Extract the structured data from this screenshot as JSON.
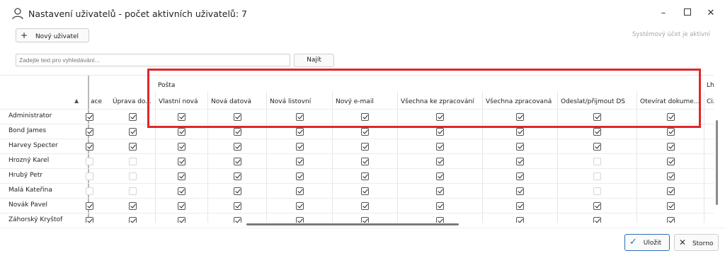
{
  "window": {
    "title": "Nastavení uživatelů - počet aktivních uživatelů: 7"
  },
  "toolbar": {
    "new_user": "Nový uživatel",
    "system_note": "Systémový účet je aktivní"
  },
  "search": {
    "placeholder": "Zadejte text pro vyhledávání...",
    "find_label": "Najít"
  },
  "grid": {
    "group_header": "Pošta",
    "partial_left": "ace",
    "partial_right_group": "Lhůty",
    "partial_right_col": "Cizí p",
    "columns": [
      "Úprava do...",
      "Vlastní nová",
      "Nová datová",
      "Nová listovní",
      "Nový e-mail",
      "Všechna ke zpracování",
      "Všechna zpracovaná",
      "Odeslat/přijmout DS",
      "Otevírat dokume..."
    ],
    "rows": [
      {
        "name": "Administrator",
        "values": [
          true,
          true,
          true,
          true,
          true,
          true,
          true,
          true,
          true,
          true
        ]
      },
      {
        "name": "Bond James",
        "values": [
          true,
          true,
          true,
          true,
          true,
          true,
          true,
          true,
          true,
          true
        ]
      },
      {
        "name": "Harvey Specter",
        "values": [
          true,
          true,
          true,
          true,
          true,
          true,
          true,
          true,
          true,
          true
        ]
      },
      {
        "name": "Hrozný Karel",
        "values": [
          false,
          false,
          true,
          true,
          true,
          true,
          true,
          true,
          false,
          true
        ]
      },
      {
        "name": "Hrubý Petr",
        "values": [
          false,
          false,
          true,
          true,
          true,
          true,
          true,
          true,
          false,
          true
        ]
      },
      {
        "name": "Malá Kateřina",
        "values": [
          false,
          false,
          true,
          true,
          true,
          true,
          true,
          true,
          false,
          true
        ]
      },
      {
        "name": "Novák Pavel",
        "values": [
          true,
          true,
          true,
          true,
          true,
          true,
          true,
          true,
          true,
          true
        ]
      },
      {
        "name": "Záhorský Kryštof",
        "values": [
          true,
          true,
          true,
          true,
          true,
          true,
          true,
          true,
          true,
          true
        ]
      }
    ]
  },
  "footer": {
    "save": "Uložit",
    "cancel": "Storno"
  }
}
